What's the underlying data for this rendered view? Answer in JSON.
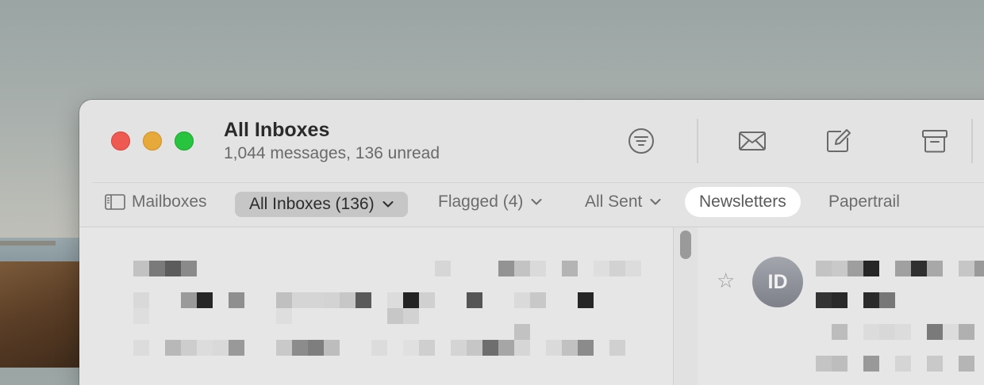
{
  "window": {
    "title": "All Inboxes",
    "subtitle": "1,044 messages, 136 unread"
  },
  "toolbar": {
    "filter_icon": "filter-icon",
    "get_mail_icon": "envelope-icon",
    "compose_icon": "compose-icon",
    "archive_icon": "archive-icon"
  },
  "favorites": {
    "mailboxes": "Mailboxes",
    "all_inboxes": "All Inboxes (136)",
    "flagged": "Flagged (4)",
    "all_sent": "All Sent",
    "newsletters": "Newsletters",
    "papertrail": "Papertrail"
  },
  "preview": {
    "avatar_initials": "ID",
    "star": "☆"
  },
  "colors": {
    "close": "#ee5a52",
    "minimize": "#e6a93a",
    "maximize": "#29c43f",
    "selected_pill": "#c6c6c6"
  }
}
